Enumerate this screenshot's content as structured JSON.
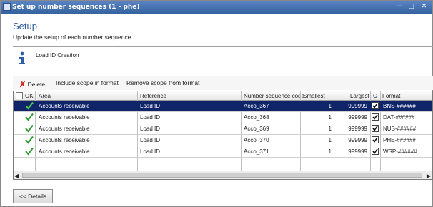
{
  "window": {
    "title": "Set up number sequences (1 - phe)"
  },
  "header": {
    "title": "Setup",
    "subtitle": "Update the setup of each number sequence"
  },
  "info": {
    "label": "Load ID Creation"
  },
  "toolbar": {
    "delete_label": "Delete",
    "include_label": "Include scope in format",
    "remove_label": "Remove scope from format"
  },
  "table": {
    "columns": {
      "ok": "OK",
      "area": "Area",
      "reference": "Reference",
      "code": "Number sequence code",
      "smallest": "Smallest",
      "largest": "Largest",
      "c": "C",
      "format": "Format"
    },
    "rows": [
      {
        "area": "Accounts receivable",
        "reference": "Load ID",
        "code": "Acco_367",
        "smallest": "1",
        "largest": "999999",
        "format": "BNS-######",
        "ok": true,
        "c_checked": true,
        "selected": true
      },
      {
        "area": "Accounts receivable",
        "reference": "Load ID",
        "code": "Acco_368",
        "smallest": "1",
        "largest": "999999",
        "format": "DAT-######",
        "ok": true,
        "c_checked": true,
        "selected": false
      },
      {
        "area": "Accounts receivable",
        "reference": "Load ID",
        "code": "Acco_369",
        "smallest": "1",
        "largest": "999999",
        "format": "NUS-######",
        "ok": true,
        "c_checked": true,
        "selected": false
      },
      {
        "area": "Accounts receivable",
        "reference": "Load ID",
        "code": "Acco_370",
        "smallest": "1",
        "largest": "999999",
        "format": "PHE-######",
        "ok": true,
        "c_checked": true,
        "selected": false
      },
      {
        "area": "Accounts receivable",
        "reference": "Load ID",
        "code": "Acco_371",
        "smallest": "1",
        "largest": "999999",
        "format": "WSP-######",
        "ok": true,
        "c_checked": true,
        "selected": false
      }
    ]
  },
  "footer": {
    "details_label": "<< Details"
  },
  "colors": {
    "accent": "#2e5c9a",
    "selected_row": "#10246a",
    "check_green": "#2e9a2e",
    "delete_red": "#d0281f"
  },
  "icons": [
    "app-icon",
    "minimize-icon",
    "maximize-icon",
    "close-icon",
    "info-icon",
    "delete-icon",
    "checkmark-icon",
    "checkbox-icon"
  ]
}
